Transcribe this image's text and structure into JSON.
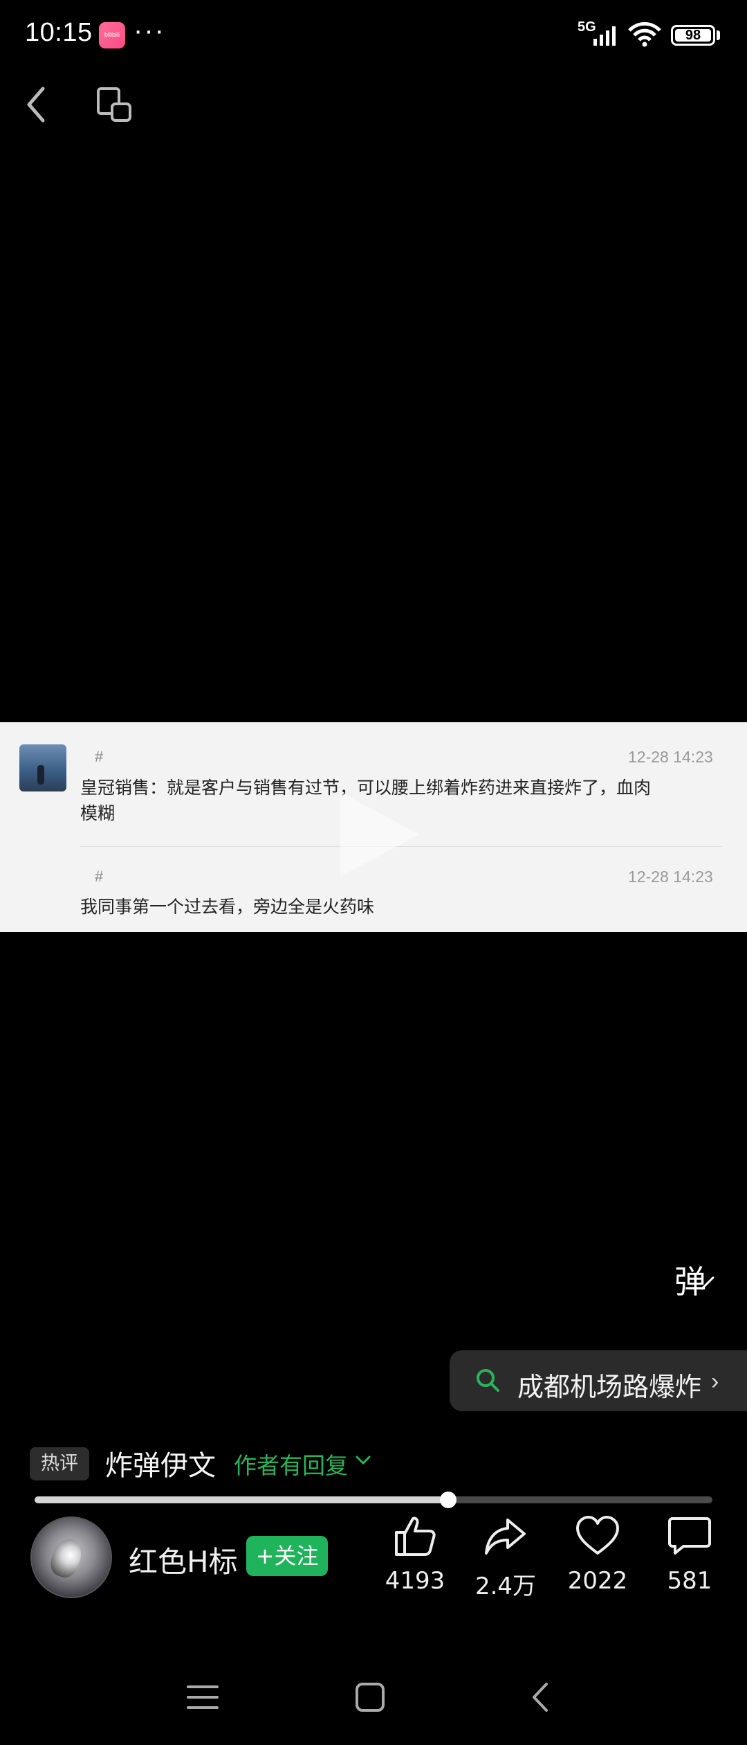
{
  "status_bar": {
    "time": "10:15",
    "app_badge": "bilibili",
    "more": "···",
    "network": "5G",
    "battery": "98"
  },
  "comments": [
    {
      "hash": "#",
      "time": "12-28 14:23",
      "text_line1": "皇冠销售：就是客户与销售有过节，可以腰上绑着炸药进来直接炸了，血肉",
      "text_line2": "模糊"
    },
    {
      "hash": "#",
      "time": "12-28 14:23",
      "text_line1": "我同事第一个过去看，旁边全是火药味"
    }
  ],
  "danmaku_label": "弹",
  "search": {
    "label": "成都机场路爆炸",
    "icon": "search-icon"
  },
  "hot_comment": {
    "badge": "热评",
    "text": "炸弹伊文",
    "reply_note": "作者有回复"
  },
  "progress": {
    "fraction": 0.61
  },
  "author": {
    "name": "红色H标",
    "follow_label": "+关注"
  },
  "actions": {
    "like_count": "4193",
    "share_count": "2.4万",
    "favorite_count": "2022",
    "comment_count": "581"
  },
  "colors": {
    "accent_green": "#1fb35b",
    "background": "#000000",
    "card_background": "#f3f3f3"
  }
}
